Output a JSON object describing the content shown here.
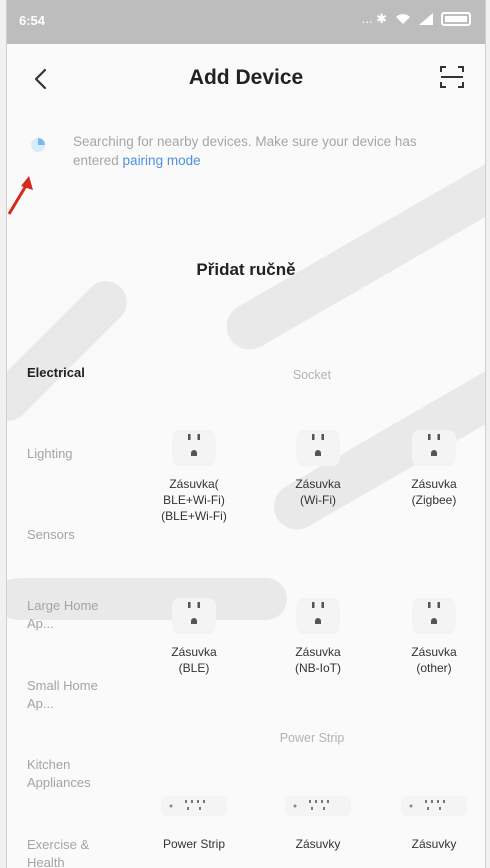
{
  "status_bar": {
    "time": "6:54",
    "icons_text": "... ✱"
  },
  "header": {
    "title": "Add Device"
  },
  "searching": {
    "text": "Searching for nearby devices. Make sure your device has entered ",
    "link": "pairing mode"
  },
  "manual_heading": "Přidat ručně",
  "categories": [
    "Electrical",
    "Lighting",
    "Sensors",
    "Large Home Ap...",
    "Small Home Ap...",
    "Kitchen Appliances",
    "Exercise & Health"
  ],
  "sections": {
    "socket": "Socket",
    "power_strip": "Power Strip"
  },
  "socket_devices": [
    "Zásuvka( BLE+Wi-Fi) (BLE+Wi-Fi)",
    "Zásuvka (Wi-Fi)",
    "Zásuvka (Zigbee)",
    "Zásuvka (BLE)",
    "Zásuvka (NB-IoT)",
    "Zásuvka (other)"
  ],
  "strip_devices": [
    "Power Strip",
    "Zásuvky",
    "Zásuvky"
  ],
  "colors": {
    "link": "#4d90e0",
    "muted": "#a4a4a4",
    "status_bar": "#bdbdbd"
  }
}
